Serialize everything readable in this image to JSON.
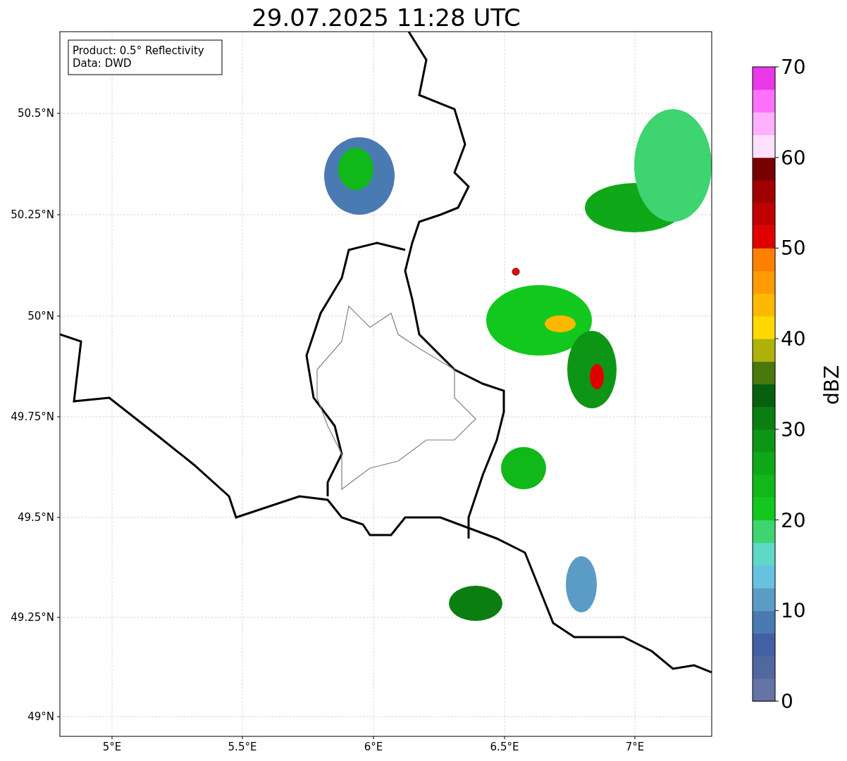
{
  "title": "29.07.2025 11:28 UTC",
  "info_box": [
    "Product: 0.5° Reflectivity",
    "Data: DWD"
  ],
  "lat_ticks": [
    "50.5°N",
    "50.25°N",
    "50°N",
    "49.75°N",
    "49.5°N",
    "49.25°N",
    "49°N"
  ],
  "lon_ticks": [
    "5°E",
    "5.5°E",
    "6°E",
    "6.5°E",
    "7°E"
  ],
  "colorbar": {
    "label": "dBZ",
    "ticks": [
      "70",
      "60",
      "50",
      "40",
      "30",
      "20",
      "10",
      "0"
    ],
    "segments": [
      {
        "color": "#6474a4"
      },
      {
        "color": "#50689e"
      },
      {
        "color": "#4260a2"
      },
      {
        "color": "#4a7ab2"
      },
      {
        "color": "#5a9cc6"
      },
      {
        "color": "#66c2de"
      },
      {
        "color": "#60d8c6"
      },
      {
        "color": "#3ed470"
      },
      {
        "color": "#12c81c"
      },
      {
        "color": "#10b81a"
      },
      {
        "color": "#0fa818"
      },
      {
        "color": "#0d9616"
      },
      {
        "color": "#0b7e12"
      },
      {
        "color": "#08600e"
      },
      {
        "color": "#4a780c"
      },
      {
        "color": "#b0b00a"
      },
      {
        "color": "#ffd800"
      },
      {
        "color": "#ffb800"
      },
      {
        "color": "#ff9a00"
      },
      {
        "color": "#ff8000"
      },
      {
        "color": "#e00000"
      },
      {
        "color": "#c00000"
      },
      {
        "color": "#a00000"
      },
      {
        "color": "#780000"
      },
      {
        "color": "#ffe0ff"
      },
      {
        "color": "#ffb0ff"
      },
      {
        "color": "#ff70ff"
      },
      {
        "color": "#e838e8"
      }
    ]
  }
}
